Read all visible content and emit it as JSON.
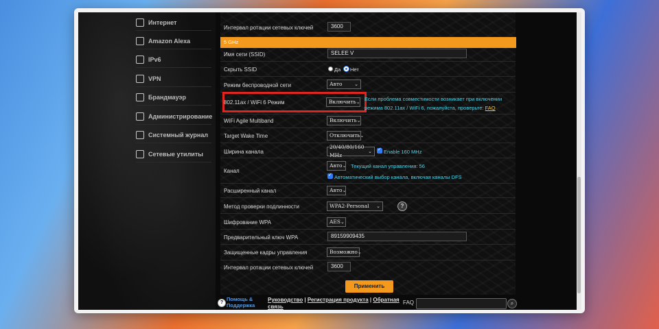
{
  "sidebar": {
    "items": [
      {
        "label": "Интернет",
        "icon": "globe-icon"
      },
      {
        "label": "Amazon Alexa",
        "icon": "alexa-icon"
      },
      {
        "label": "IPv6",
        "icon": "ipv6-icon"
      },
      {
        "label": "VPN",
        "icon": "vpn-icon"
      },
      {
        "label": "Брандмауэр",
        "icon": "firewall-icon"
      },
      {
        "label": "Администрирование",
        "icon": "admin-icon"
      },
      {
        "label": "Системный журнал",
        "icon": "log-icon"
      },
      {
        "label": "Сетевые утилиты",
        "icon": "tools-icon"
      }
    ]
  },
  "top": {
    "label": "Интервал ротации сетевых ключей",
    "value": "3600"
  },
  "section": {
    "title": "5 GHz"
  },
  "rows": {
    "ssid": {
      "label": "Имя сети (SSID)",
      "value": "SELEE V"
    },
    "hide_ssid": {
      "label": "Скрыть SSID",
      "yes": "Да",
      "no": "Нет",
      "selected": "Нет"
    },
    "wireless_mode": {
      "label": "Режим беспроводной сети",
      "value": "Авто"
    },
    "wifi6": {
      "label": "802.11ax / WiFi 6 Режим",
      "value": "Включить",
      "note1": "Если проблема совместимости возникает при включении",
      "note2": "режима 802.11ax / WiFi 6, пожалуйста, проверьте:",
      "note_link": "FAQ"
    },
    "multiband": {
      "label": "WiFi Agile Multiband",
      "value": "Включить"
    },
    "twt": {
      "label": "Target Wake Time",
      "value": "Отключить"
    },
    "bandwidth": {
      "label": "Ширина канала",
      "value": "20/40/80/160 MHz",
      "check_label": "Enable 160 MHz"
    },
    "channel": {
      "label": "Канал",
      "value": "Авто",
      "current": "Текущий канал управления: 56",
      "dfs": "Автоматический выбор канала, включая каналы DFS"
    },
    "ext_channel": {
      "label": "Расширенный канал",
      "value": "Авто"
    },
    "auth": {
      "label": "Метод проверки подлинности",
      "value": "WPA2-Personal"
    },
    "encryption": {
      "label": "Шифрование WPA",
      "value": "AES"
    },
    "psk": {
      "label": "Предварительный ключ WPA",
      "value": "89159909435"
    },
    "pmf": {
      "label": "Защищенные кадры управления",
      "value": "Возможно"
    },
    "rotation": {
      "label": "Интервал ротации сетевых ключей",
      "value": "3600"
    }
  },
  "apply_label": "Применить",
  "footer": {
    "help": "Помощь &",
    "help2": "Поддержка",
    "manual": "Руководство",
    "register": "Регистрация продукта",
    "feedback": "Обратная",
    "feedback2": "связь",
    "faq": "FAQ"
  },
  "colors": {
    "accent": "#f39a1e",
    "note": "#4fd3e8",
    "highlight": "#e0241f"
  }
}
